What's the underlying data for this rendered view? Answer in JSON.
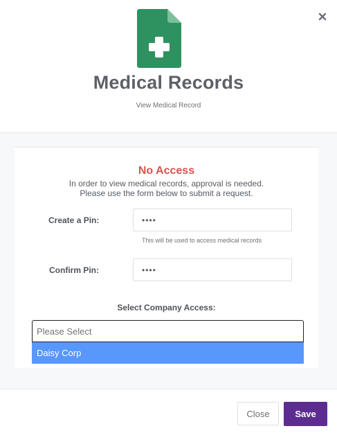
{
  "header": {
    "title": "Medical Records",
    "subtitle": "View Medical Record",
    "icon": "medical-document-icon",
    "icon_color": "#2e9160",
    "close_icon": "close-icon"
  },
  "body": {
    "status_title": "No Access",
    "notice_line1": "In order to view medical records, approval is needed.",
    "notice_line2": "Please use the form below to submit a request.",
    "create_pin": {
      "label": "Create a Pin:",
      "value": "••••",
      "help": "This will be used to access medical records"
    },
    "confirm_pin": {
      "label": "Confirm Pin:",
      "value": "••••"
    },
    "company": {
      "label": "Select Company Access:",
      "placeholder": "Please Select",
      "options": [
        "Daisy Corp"
      ]
    }
  },
  "footer": {
    "close_label": "Close",
    "save_label": "Save",
    "save_color": "#5d2c91"
  }
}
